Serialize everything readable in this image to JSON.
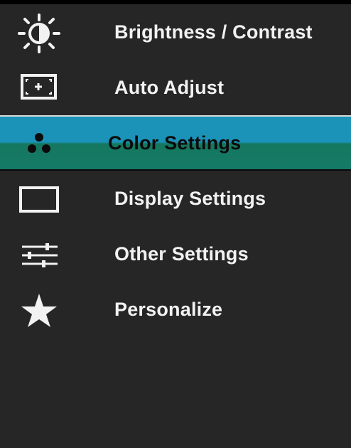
{
  "menu": {
    "items": [
      {
        "label": "Brightness / Contrast",
        "icon": "brightness-icon",
        "selected": false
      },
      {
        "label": "Auto Adjust",
        "icon": "auto-adjust-icon",
        "selected": false
      },
      {
        "label": "Color Settings",
        "icon": "color-dots-icon",
        "selected": true
      },
      {
        "label": "Display Settings",
        "icon": "display-rectangle-icon",
        "selected": false
      },
      {
        "label": "Other Settings",
        "icon": "sliders-icon",
        "selected": false
      },
      {
        "label": "Personalize",
        "icon": "star-icon",
        "selected": false
      }
    ]
  },
  "colors": {
    "background": "#262626",
    "text": "#f2f2f2",
    "selected_top": "#1b93b8",
    "selected_bottom": "#15775f",
    "selected_text": "#0b0b0b"
  }
}
